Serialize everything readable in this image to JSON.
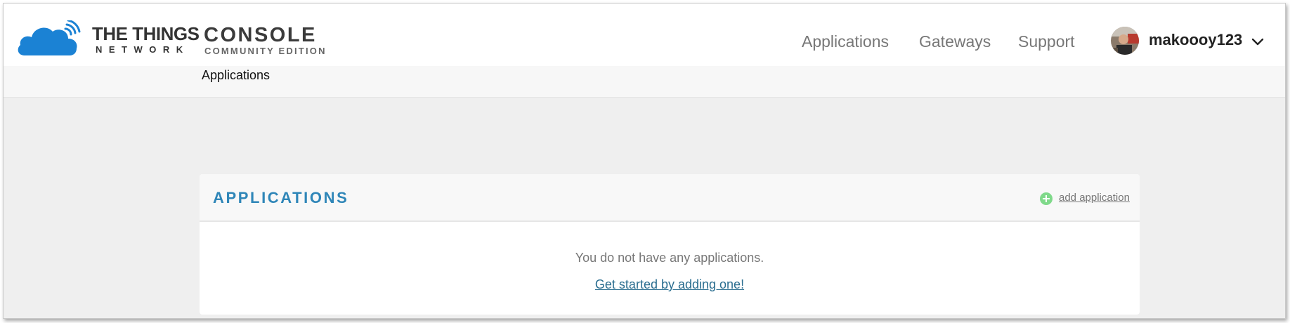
{
  "header": {
    "brand_line1": "THE THINGS",
    "brand_line2": "NETWORK",
    "console_title": "CONSOLE",
    "console_subtitle": "COMMUNITY EDITION",
    "logo_icon": "cloud-signal-icon",
    "nav": [
      {
        "label": "Applications"
      },
      {
        "label": "Gateways"
      },
      {
        "label": "Support"
      }
    ],
    "user": {
      "username": "makoooy123",
      "avatar_icon": "avatar",
      "menu_icon": "chevron-down-icon"
    }
  },
  "breadcrumb": {
    "label": "Applications"
  },
  "applications": {
    "title": "APPLICATIONS",
    "add_label": "add application",
    "add_icon": "plus-circle-icon",
    "empty_message": "You do not have any applications.",
    "get_started": "Get started by adding one!"
  },
  "colors": {
    "brand_blue": "#1b82d4",
    "title_blue": "#2f86b8",
    "add_green": "#7fd98a",
    "link_blue": "#2b6e90",
    "page_bg": "#efefef"
  }
}
